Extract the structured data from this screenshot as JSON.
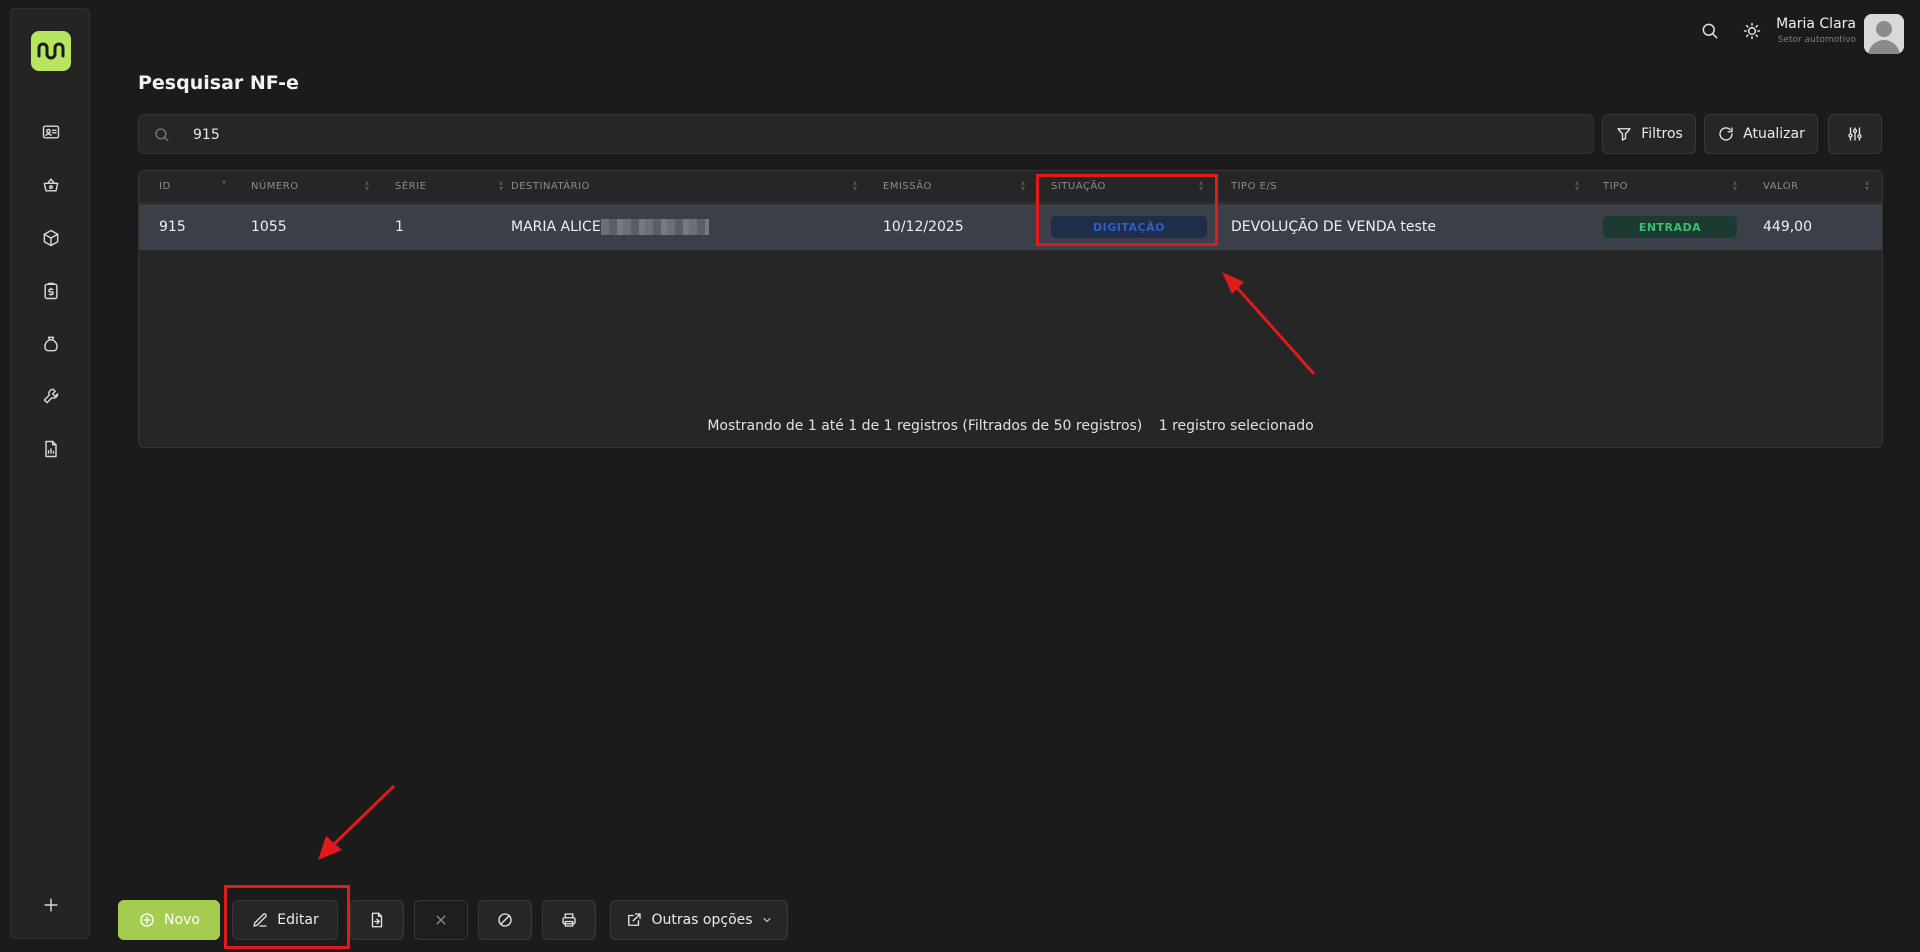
{
  "sidebar": {
    "items": [
      "id-card-icon",
      "basket-icon",
      "box-icon",
      "receipt-dollar-icon",
      "money-bag-icon",
      "wrench-icon",
      "report-icon"
    ],
    "add_icon": "plus-icon"
  },
  "topbar": {
    "user_name": "Maria Clara",
    "user_role": "Setor automotivo"
  },
  "page": {
    "title": "Pesquisar NF-e"
  },
  "search": {
    "value": "915"
  },
  "toolbar": {
    "filters_label": "Filtros",
    "refresh_label": "Atualizar"
  },
  "table": {
    "columns": [
      "ID",
      "NÚMERO",
      "SÉRIE",
      "DESTINATÁRIO",
      "EMISSÃO",
      "SITUAÇÃO",
      "TIPO E/S",
      "TIPO",
      "VALOR"
    ],
    "rows": [
      {
        "id": "915",
        "numero": "1055",
        "serie": "1",
        "destinatario": "MARIA ALICE",
        "emissao": "10/12/2025",
        "situacao": "DIGITAÇÃO",
        "tipo_es": "DEVOLUÇÃO DE VENDA teste",
        "tipo": "ENTRADA",
        "valor": "449,00"
      }
    ],
    "footer_count": "Mostrando de 1 até 1 de 1 registros (Filtrados de 50 registros)",
    "footer_selected": "1 registro selecionado"
  },
  "actions": {
    "new_label": "Novo",
    "edit_label": "Editar",
    "more_label": "Outras opções"
  },
  "colors": {
    "accent": "#b7e561",
    "annotation": "#e11b1b",
    "status_typing": "#2f5fc4",
    "status_entry": "#3fbf6b"
  }
}
